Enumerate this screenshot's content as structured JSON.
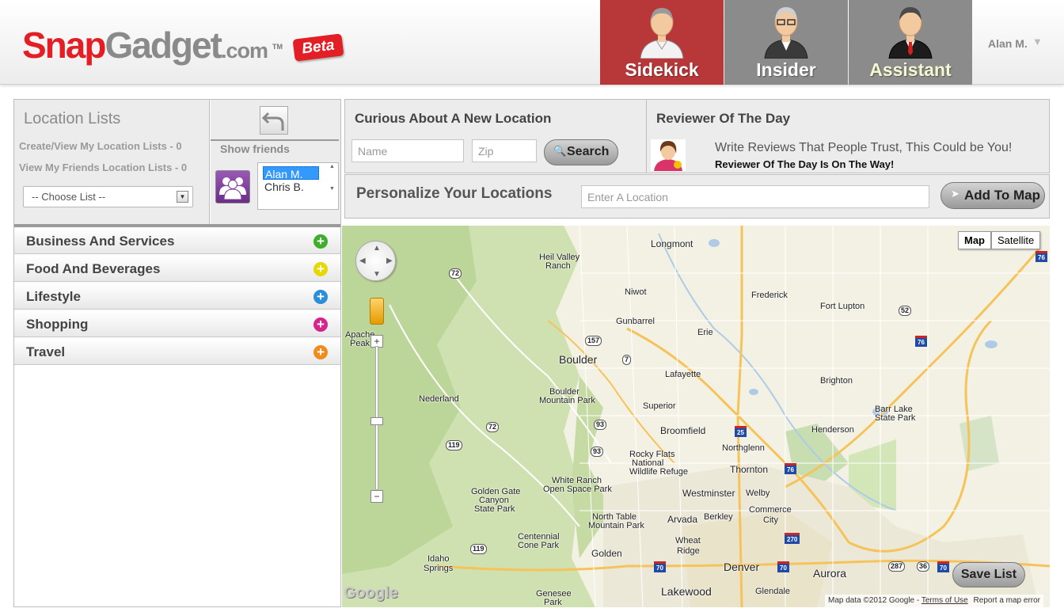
{
  "brand": {
    "snap": "Snap",
    "gadget": "Gadget",
    "dotcom": ".com",
    "tm": "TM",
    "beta": "Beta"
  },
  "roles": [
    {
      "label": "Sidekick",
      "active": true
    },
    {
      "label": "Insider",
      "active": false
    },
    {
      "label": "Assistant",
      "active": false
    }
  ],
  "user": {
    "name": "Alan M."
  },
  "location_lists": {
    "title": "Location Lists",
    "create_view": "Create/View My Location Lists - 0",
    "friends_lists": "View My Friends Location Lists - 0",
    "choose_list": "-- Choose List --"
  },
  "friends": {
    "show_label": "Show friends",
    "list": [
      "Alan M.",
      "Chris B."
    ],
    "selected": "Alan M."
  },
  "categories": [
    {
      "name": "Business And Services",
      "color": "#3fae2a"
    },
    {
      "name": "Food And Beverages",
      "color": "#e6d800"
    },
    {
      "name": "Lifestyle",
      "color": "#2a8fd6"
    },
    {
      "name": "Shopping",
      "color": "#d6248f"
    },
    {
      "name": "Travel",
      "color": "#f08c1e"
    }
  ],
  "curious": {
    "title": "Curious About A New Location",
    "name_placeholder": "Name",
    "zip_placeholder": "Zip",
    "search_label": "Search"
  },
  "reviewer": {
    "title": "Reviewer Of The Day",
    "message": "Write Reviews That People Trust, This Could be You!",
    "sub": "Reviewer Of The Day Is On The Way!"
  },
  "personalize": {
    "title": "Personalize Your Locations",
    "location_placeholder": "Enter A Location",
    "add_label": "Add To Map"
  },
  "map": {
    "type_map": "Map",
    "type_satellite": "Satellite",
    "save_list": "Save List",
    "google": "Google",
    "attribution": "Map data ©2012 Google",
    "terms": "Terms of Use",
    "report": "Report a map error",
    "places": {
      "longmont": "Longmont",
      "heil": "Heil Valley",
      "ranch": "Ranch",
      "niwot": "Niwot",
      "frederick": "Frederick",
      "fortlupton": "Fort Lupton",
      "gunbarrel": "Gunbarrel",
      "erie": "Erie",
      "apache": "Apache",
      "peak": "Peak",
      "boulder": "Boulder",
      "lafayette": "Lafayette",
      "brighton": "Brighton",
      "bouldermp1": "Boulder",
      "bouldermp2": "Mountain Park",
      "nederland": "Nederland",
      "superior": "Superior",
      "barr1": "Barr Lake",
      "barr2": "State Park",
      "broomfield": "Broomfield",
      "henderson": "Henderson",
      "northglenn": "Northglenn",
      "rf1": "Rocky Flats",
      "rf2": "National",
      "rf3": "Wildlife Refuge",
      "thornton": "Thornton",
      "gg1": "Golden Gate",
      "gg2": "Canyon",
      "gg3": "State Park",
      "wr1": "White Ranch",
      "wr2": "Open Space Park",
      "westminster": "Westminster",
      "welby": "Welby",
      "cc1": "Commerce",
      "cc2": "City",
      "ntm1": "North Table",
      "ntm2": "Mountain Park",
      "arvada": "Arvada",
      "berkley": "Berkley",
      "cc3": "Centennial",
      "cc4": "Cone Park",
      "wheat1": "Wheat",
      "wheat2": "Ridge",
      "golden": "Golden",
      "idaho1": "Idaho",
      "idaho2": "Springs",
      "denver": "Denver",
      "aurora": "Aurora",
      "lakewood": "Lakewood",
      "glendale": "Glendale",
      "genesee1": "Genesee",
      "genesee2": "Park"
    },
    "highways": [
      "72",
      "157",
      "7",
      "93",
      "72",
      "119",
      "52",
      "93",
      "119",
      "25",
      "76",
      "76",
      "270",
      "70",
      "70",
      "287",
      "36",
      "70",
      "76"
    ]
  }
}
